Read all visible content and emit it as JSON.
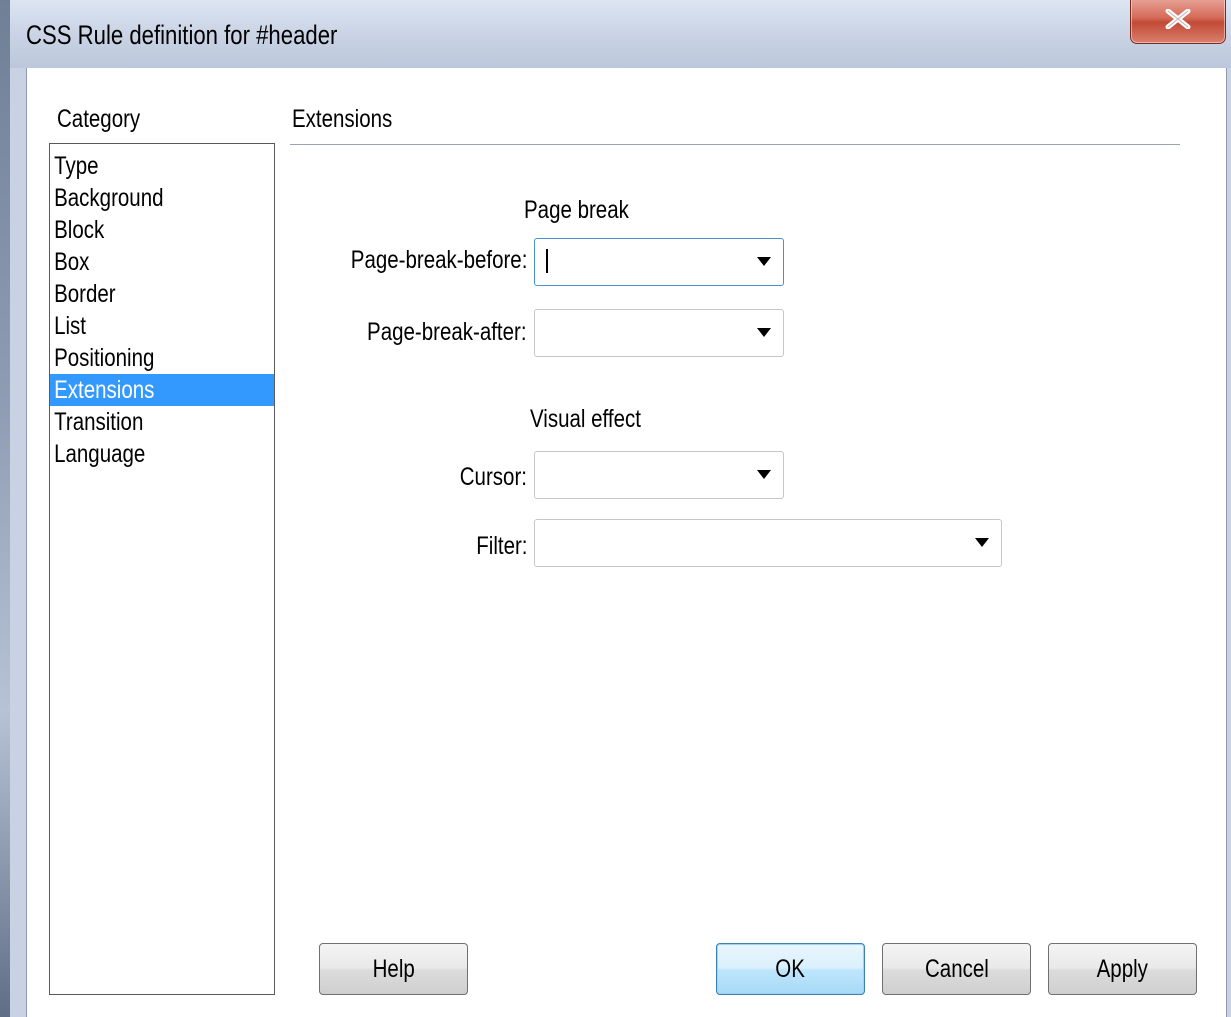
{
  "window": {
    "title": "CSS Rule definition for #header",
    "close_glyph": "X"
  },
  "category": {
    "label": "Category",
    "items": [
      "Type",
      "Background",
      "Block",
      "Box",
      "Border",
      "List",
      "Positioning",
      "Extensions",
      "Transition",
      "Language"
    ],
    "selected": "Extensions"
  },
  "panel": {
    "title": "Extensions",
    "page_break": {
      "title": "Page break",
      "before_label": "Page-break-before:",
      "before_value": "",
      "after_label": "Page-break-after:",
      "after_value": ""
    },
    "visual_effect": {
      "title": "Visual effect",
      "cursor_label": "Cursor:",
      "cursor_value": "",
      "filter_label": "Filter:",
      "filter_value": ""
    }
  },
  "buttons": {
    "help": "Help",
    "ok": "OK",
    "cancel": "Cancel",
    "apply": "Apply"
  },
  "colors": {
    "selection": "#3399ff",
    "title_bar": "#c8d2e4",
    "close_button": "#d46a58"
  }
}
